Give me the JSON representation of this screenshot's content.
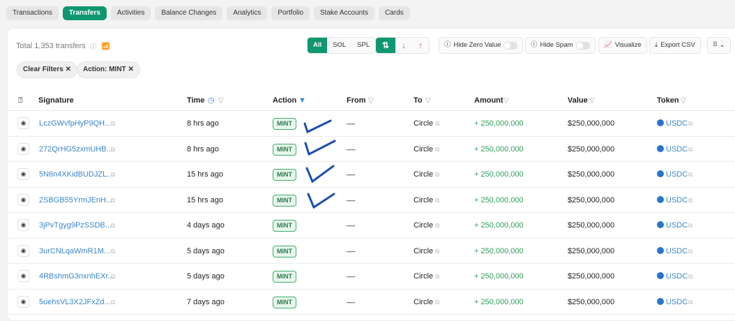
{
  "tabs": [
    "Transactions",
    "Transfers",
    "Activities",
    "Balance Changes",
    "Analytics",
    "Portfolio",
    "Stake Accounts",
    "Cards"
  ],
  "active_tab": "Transfers",
  "total": "Total 1,353 transfers",
  "filters": {
    "clear": "Clear Filters",
    "action": "Action: MINT"
  },
  "toolbar": {
    "all": "All",
    "sol": "SOL",
    "spl": "SPL",
    "both": "⇅",
    "in": "↓",
    "out": "↑",
    "hide_zero": "Hide Zero Value",
    "hide_spam": "Hide Spam",
    "visualize": "Visualize",
    "export": "Export CSV",
    "more": "⠿ ⌄"
  },
  "columns": {
    "signature": "Signature",
    "time": "Time",
    "action": "Action",
    "from": "From",
    "to": "To",
    "amount": "Amount",
    "value": "Value",
    "token": "Token"
  },
  "rows": [
    {
      "sig": "LczGWvfpHyP9QH...",
      "time": "8 hrs ago",
      "action": "MINT",
      "from": "__",
      "to": "Circle",
      "amount": "+ 250,000,000",
      "value": "$250,000,000",
      "token": "USDC"
    },
    {
      "sig": "272QrHG5zxmUHB...",
      "time": "8 hrs ago",
      "action": "MINT",
      "from": "__",
      "to": "Circle",
      "amount": "+ 250,000,000",
      "value": "$250,000,000",
      "token": "USDC"
    },
    {
      "sig": "5N6n4XKidBUDJZL...",
      "time": "15 hrs ago",
      "action": "MINT",
      "from": "__",
      "to": "Circle",
      "amount": "+ 250,000,000",
      "value": "$250,000,000",
      "token": "USDC"
    },
    {
      "sig": "2SBGB55YrmJEnH...",
      "time": "15 hrs ago",
      "action": "MINT",
      "from": "__",
      "to": "Circle",
      "amount": "+ 250,000,000",
      "value": "$250,000,000",
      "token": "USDC"
    },
    {
      "sig": "3jPvTgyg9PzSSDB...",
      "time": "4 days ago",
      "action": "MINT",
      "from": "__",
      "to": "Circle",
      "amount": "+ 250,000,000",
      "value": "$250,000,000",
      "token": "USDC"
    },
    {
      "sig": "3urCNLqaWmR1M...",
      "time": "5 days ago",
      "action": "MINT",
      "from": "__",
      "to": "Circle",
      "amount": "+ 250,000,000",
      "value": "$250,000,000",
      "token": "USDC"
    },
    {
      "sig": "4RBshmG3nxnhEXr...",
      "time": "5 days ago",
      "action": "MINT",
      "from": "__",
      "to": "Circle",
      "amount": "+ 250,000,000",
      "value": "$250,000,000",
      "token": "USDC"
    },
    {
      "sig": "5uehsVL3X2JFxZd...",
      "time": "7 days ago",
      "action": "MINT",
      "from": "__",
      "to": "Circle",
      "amount": "+ 250,000,000",
      "value": "$250,000,000",
      "token": "USDC"
    }
  ]
}
